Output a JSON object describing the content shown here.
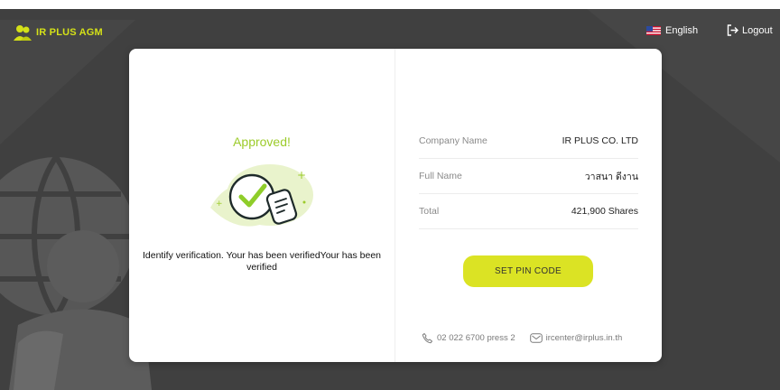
{
  "header": {
    "logo_text": "IR PLUS AGM",
    "language": "English",
    "logout": "Logout"
  },
  "status": {
    "title": "Approved!",
    "message": "Identify verification. Your has been verifiedYour has been verified"
  },
  "info": [
    {
      "label": "Company Name",
      "value": "IR PLUS CO. LTD"
    },
    {
      "label": "Full Name",
      "value": "วาสนา ดีงาน"
    },
    {
      "label": "Total",
      "value": "421,900 Shares"
    }
  ],
  "actions": {
    "set_pin": "SET PIN CODE"
  },
  "contact": {
    "phone": "02 022 6700 press 2",
    "email": "ircenter@irplus.in.th"
  },
  "colors": {
    "accent": "#dbe324",
    "success": "#9ccb2a",
    "background": "#404040"
  }
}
